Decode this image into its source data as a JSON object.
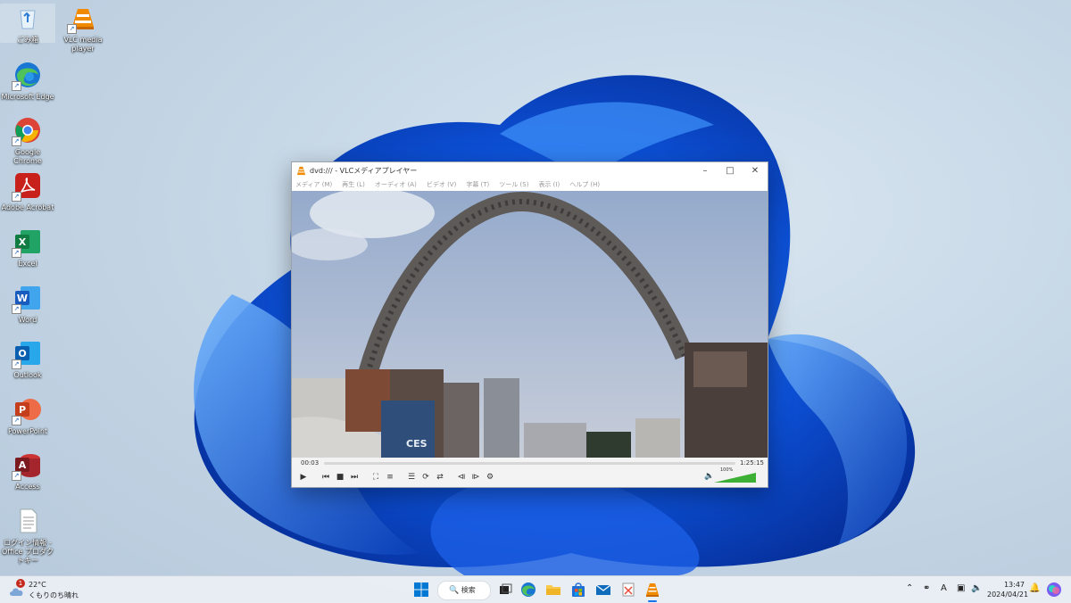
{
  "desktop": {
    "icons": [
      {
        "label": "ごみ箱",
        "name": "recycle-bin"
      },
      {
        "label": "VLC media player",
        "name": "vlc"
      },
      {
        "label": "Microsoft Edge",
        "name": "edge"
      },
      {
        "label": "Google Chrome",
        "name": "chrome"
      },
      {
        "label": "Adobe Acrobat",
        "name": "acrobat"
      },
      {
        "label": "Excel",
        "name": "excel"
      },
      {
        "label": "Word",
        "name": "word"
      },
      {
        "label": "Outlook",
        "name": "outlook"
      },
      {
        "label": "PowerPoint",
        "name": "powerpoint"
      },
      {
        "label": "Access",
        "name": "access"
      },
      {
        "label": "ログイン情報 - Office プロダクトキー",
        "name": "text-document"
      }
    ]
  },
  "vlc": {
    "title": "dvd:/// - VLCメディアプレイヤー",
    "menu": [
      "メディア (M)",
      "再生 (L)",
      "オーディオ (A)",
      "ビデオ (V)",
      "字幕 (T)",
      "ツール (S)",
      "表示 (I)",
      "ヘルプ (H)"
    ],
    "time_current": "00:03",
    "time_total": "1:25:15",
    "progress": 0.0006,
    "volume_label": "100%",
    "volume": 1.0
  },
  "taskbar": {
    "weather_temp": "22°C",
    "weather_desc": "くもりのち晴れ",
    "notification_count": "1",
    "search_label": "検索",
    "ime_label": "A",
    "time": "13:47",
    "date": "2024/04/21"
  },
  "colors": {
    "accent": "#1a73e8",
    "vlc_orange": "#f08a00",
    "volume_green": "#3cb034"
  }
}
